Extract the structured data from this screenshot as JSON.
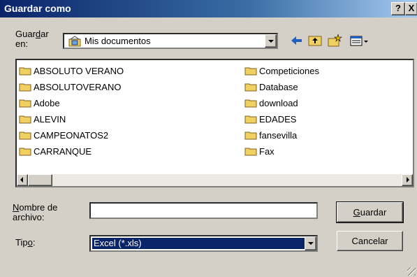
{
  "window": {
    "title": "Guardar como",
    "help": "?",
    "close": "X"
  },
  "location": {
    "label_line1": "Guar",
    "label_mnemonic": "d",
    "label_line1_rest": "ar",
    "label_line2": "en:",
    "value": "Mis documentos"
  },
  "toolbar": {
    "icons": [
      "back-arrow-icon",
      "up-folder-icon",
      "new-folder-icon",
      "view-menu-icon"
    ]
  },
  "files": {
    "left_column": [
      "ABSOLUTO VERANO",
      "ABSOLUTOVERANO",
      "Adobe",
      "ALEVIN",
      "CAMPEONATOS2",
      "CARRANQUE"
    ],
    "right_column": [
      "Competiciones",
      "Database",
      "download",
      "EDADES",
      "fansevilla",
      "Fax"
    ]
  },
  "filename": {
    "label_mnemonic": "N",
    "label_rest": "ombre de",
    "label_line2": "archivo:",
    "value": ""
  },
  "filetype": {
    "label_pre": "Tip",
    "label_mnemonic": "o",
    "label_post": ":",
    "value": "Excel (*.xls)"
  },
  "buttons": {
    "save_mnemonic": "G",
    "save_rest": "uardar",
    "cancel": "Cancelar"
  },
  "colors": {
    "title_bar": "#0a246a",
    "selection": "#0a246a",
    "folder": "#f0d060"
  }
}
